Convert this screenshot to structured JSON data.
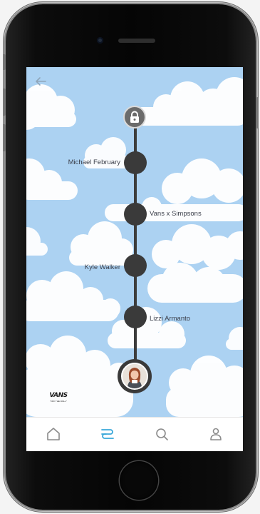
{
  "timeline": {
    "nodes": [
      {
        "label": "Michael February",
        "side": "left"
      },
      {
        "label": "Vans x Simpsons",
        "side": "right"
      },
      {
        "label": "Kyle Walker",
        "side": "left"
      },
      {
        "label": "Lizzi Armanto",
        "side": "right"
      }
    ],
    "top_icon": "lock-icon",
    "current_icon": "avatar"
  },
  "brand": {
    "name": "VANS",
    "tagline": "\"OFF THE WALL\""
  },
  "nav": {
    "items": [
      "home-icon",
      "timeline-icon",
      "search-icon",
      "profile-icon"
    ],
    "active_index": 1,
    "active_color": "#39a7d9",
    "inactive_color": "#8a8a8a"
  },
  "colors": {
    "sky": "#acd2f2",
    "node": "#3a3a3a"
  }
}
